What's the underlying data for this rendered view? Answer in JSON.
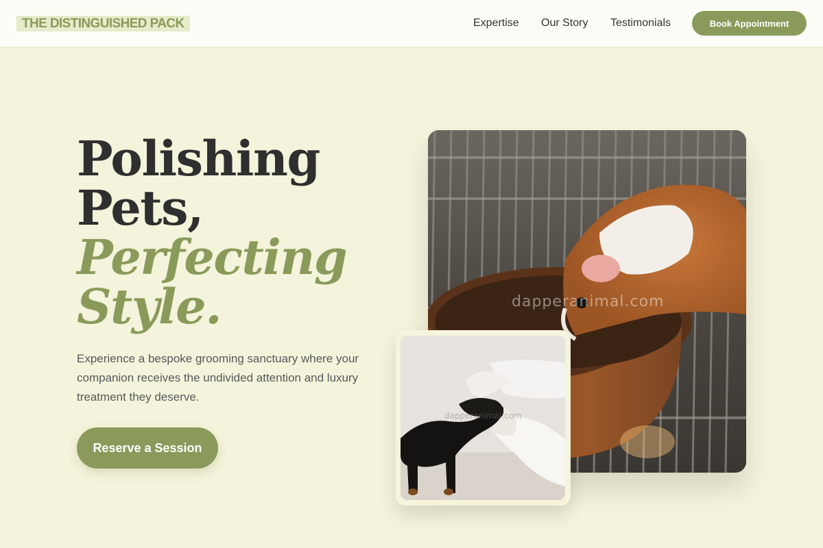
{
  "header": {
    "logo": "THE DISTINGUISHED PACK",
    "nav": [
      "Expertise",
      "Our Story",
      "Testimonials"
    ],
    "cta": "Book Appointment"
  },
  "hero": {
    "headline_line1": "Polishing",
    "headline_line2": "Pets,",
    "headline_line3": "Perfecting",
    "headline_line4": "Style.",
    "lede": "Experience a bespoke grooming sanctuary where your companion receives the undivided attention and luxury treatment they deserve.",
    "cta": "Reserve a Session"
  },
  "images": {
    "main_watermark": "dapperanimal.com",
    "small_watermark": "dapperanimal.com"
  },
  "colors": {
    "accent": "#8a9a5b",
    "background": "#f4f3db",
    "header_bg": "#fdfdf7",
    "text_dark": "#2f2f2f"
  }
}
